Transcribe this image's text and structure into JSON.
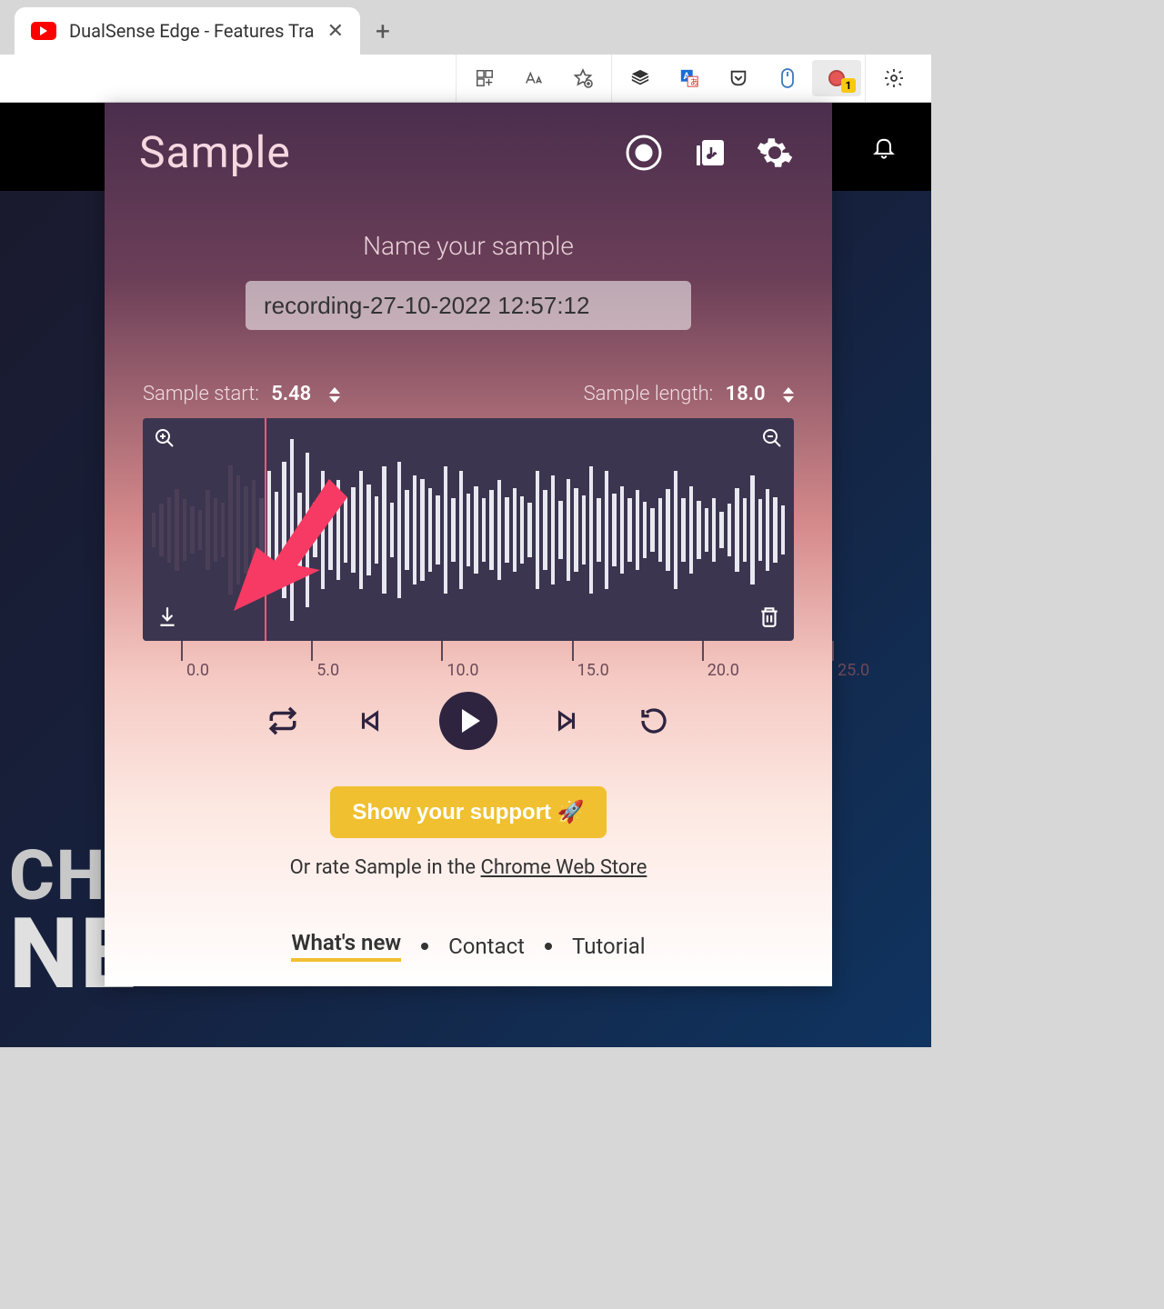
{
  "browser": {
    "tab_title": "DualSense Edge - Features Tra",
    "record_badge": "1"
  },
  "popup": {
    "title": "Sample",
    "name_label": "Name your sample",
    "name_value": "recording-27-10-2022 12:57:12",
    "sample_start_label": "Sample start:",
    "sample_start_value": "5.48",
    "sample_length_label": "Sample length:",
    "sample_length_value": "18.0",
    "timeline": [
      "0.0",
      "5.0",
      "10.0",
      "15.0",
      "20.0",
      "25.0"
    ],
    "support_label": "Show your support 🚀",
    "rate_prefix": "Or rate Sample in the ",
    "rate_link": "Chrome Web Store",
    "footer": {
      "whats_new": "What's new",
      "contact": "Contact",
      "tutorial": "Tutorial"
    }
  },
  "bg": {
    "line1": "CHA",
    "line2": "NE"
  },
  "waveform_heights": [
    38,
    58,
    72,
    90,
    68,
    52,
    44,
    88,
    70,
    60,
    142,
    120,
    96,
    110,
    70,
    130,
    84,
    150,
    200,
    82,
    170,
    60,
    130,
    88,
    110,
    72,
    94,
    130,
    100,
    74,
    140,
    60,
    150,
    88,
    120,
    112,
    92,
    76,
    140,
    70,
    130,
    80,
    96,
    70,
    88,
    110,
    72,
    92,
    74,
    60,
    130,
    88,
    120,
    64,
    112,
    92,
    76,
    140,
    70,
    130,
    80,
    96,
    70,
    88,
    62,
    48,
    70,
    90,
    130,
    70,
    96,
    64,
    48,
    70,
    40,
    58,
    92,
    70,
    120,
    68,
    90,
    72,
    54
  ]
}
